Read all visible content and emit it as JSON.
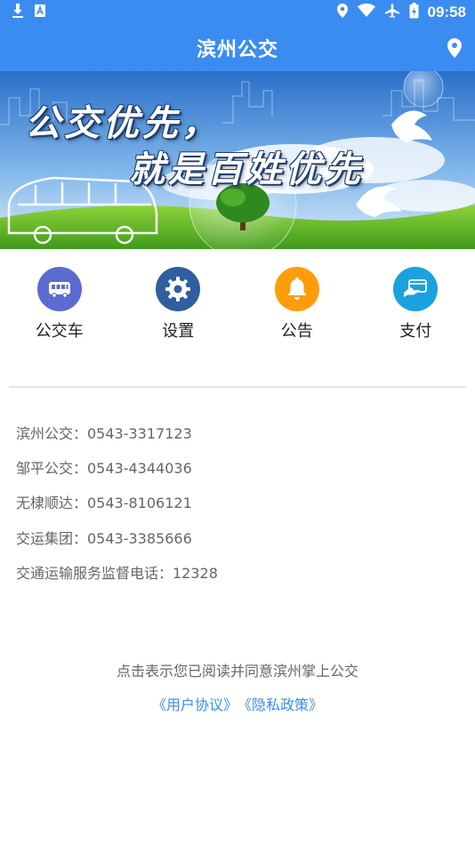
{
  "status_bar": {
    "time": "09:58",
    "left_icons": [
      "download-icon",
      "a-letter-icon"
    ],
    "right_icons": [
      "location-pin-icon",
      "wifi-icon",
      "airplane-icon",
      "battery-icon"
    ]
  },
  "app_bar": {
    "title": "滨州公交",
    "action_icon": "location-pin-icon"
  },
  "banner": {
    "line1": "公交优先，",
    "line2": "就是百姓优先"
  },
  "menu": [
    {
      "label": "公交车",
      "icon": "bus-icon",
      "color": "#5b6bcf"
    },
    {
      "label": "设置",
      "icon": "gear-icon",
      "color": "#2f5f9e"
    },
    {
      "label": "公告",
      "icon": "bell-icon",
      "color": "#ff9c0a"
    },
    {
      "label": "支付",
      "icon": "card-pay-icon",
      "color": "#1aa1e0"
    }
  ],
  "contacts": [
    "滨州公交：0543-3317123",
    "邹平公交：0543-4344036",
    "无棣顺达：0543-8106121",
    "交运集团：0543-3385666",
    "交通运输服务监督电话：12328"
  ],
  "agreement": {
    "text": "点击表示您已阅读并同意滨州掌上公交",
    "user_agreement": "《用户协议》",
    "privacy_policy": "《隐私政策》"
  },
  "colors": {
    "primary": "#3b8cf0",
    "link": "#3b8cf0",
    "text_secondary": "#666666"
  }
}
